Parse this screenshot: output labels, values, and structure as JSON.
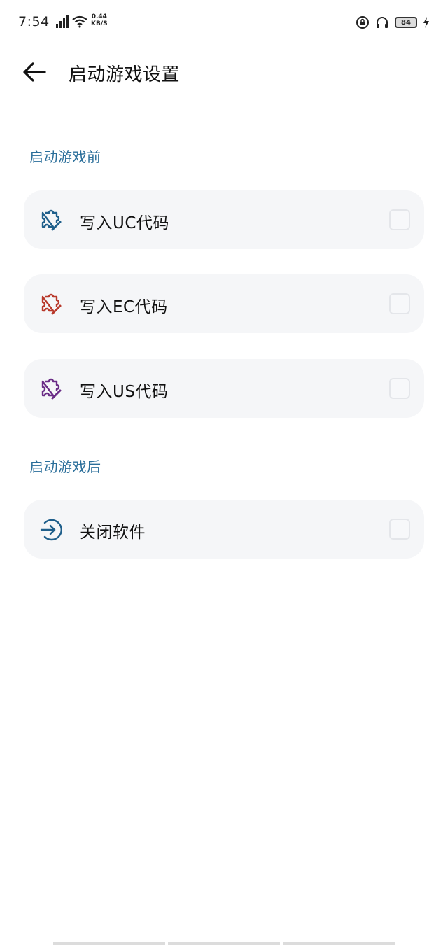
{
  "status_bar": {
    "time": "7:54",
    "net_speed_value": "0.44",
    "net_speed_unit": "KB/S",
    "battery_level": "84",
    "icons": [
      "signal-icon",
      "wifi-icon",
      "lock-rotation-icon",
      "headphones-icon",
      "battery-icon",
      "charging-icon"
    ]
  },
  "header": {
    "title": "启动游戏设置",
    "back_icon": "arrow-left-icon"
  },
  "sections": {
    "before": {
      "label": "启动游戏前",
      "items": [
        {
          "label": "写入UC代码",
          "icon": "puzzle-edit-icon",
          "icon_color": "#1f5f8b",
          "checked": false
        },
        {
          "label": "写入EC代码",
          "icon": "puzzle-edit-icon",
          "icon_color": "#b8392b",
          "checked": false
        },
        {
          "label": "写入US代码",
          "icon": "puzzle-edit-icon",
          "icon_color": "#6a2c86",
          "checked": false
        }
      ]
    },
    "after": {
      "label": "启动游戏后",
      "items": [
        {
          "label": "关闭软件",
          "icon": "exit-arrow-icon",
          "icon_color": "#1f5f8b",
          "checked": false
        }
      ]
    }
  },
  "colors": {
    "accent": "#2a6e9a",
    "card_bg": "#f5f6f8"
  }
}
